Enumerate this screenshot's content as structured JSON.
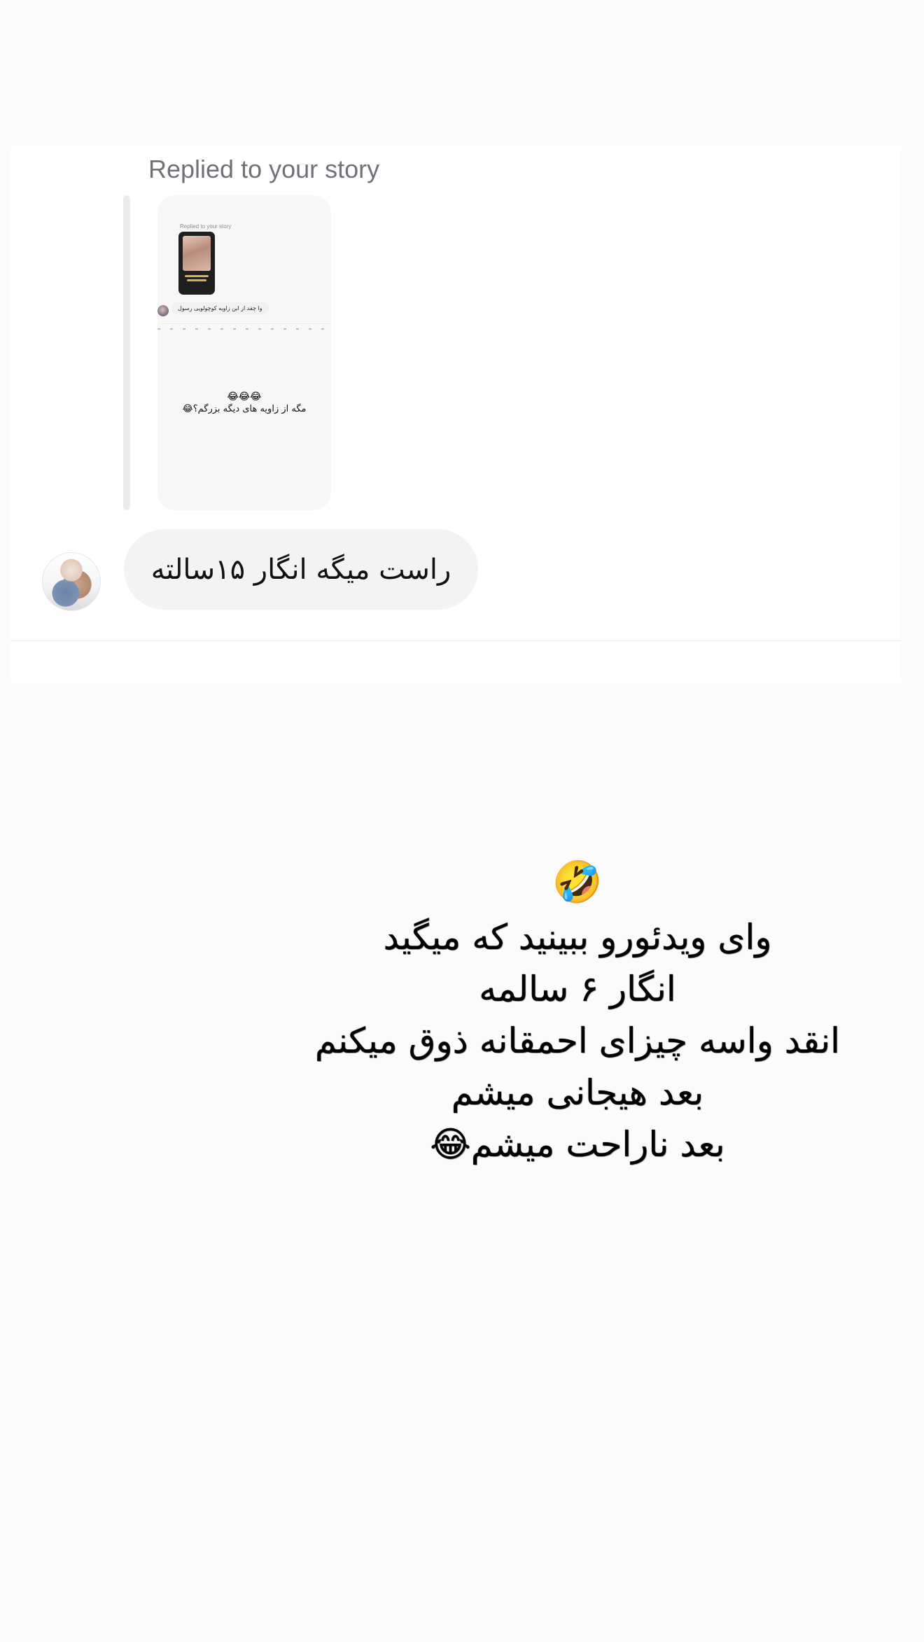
{
  "message_card": {
    "replied_label": "Replied to your story",
    "story_preview": {
      "mini_replied_label": "Replied to your story",
      "mini_reply_text": "وا چقد از این زاویه کوچولویی رسول",
      "emoji_row": "😂😂😂",
      "caption": "مگه از زاویه های دیگه بزرگم؟😂"
    },
    "message_text": "راست میگه انگار ۱۵سالته"
  },
  "story_caption": {
    "emoji_top": "🤣",
    "lines": [
      "وای ویدئورو ببینید که میگید",
      "انگار ۶ سالمه",
      "انقد واسه چیزای احمقانه ذوق میکنم",
      "بعد هیجانی میشم",
      "بعد ناراحت میشم😂"
    ]
  },
  "colors": {
    "background": "#fbfbfb",
    "bubble": "#f2f3f5",
    "label_gray": "#6f7379"
  }
}
